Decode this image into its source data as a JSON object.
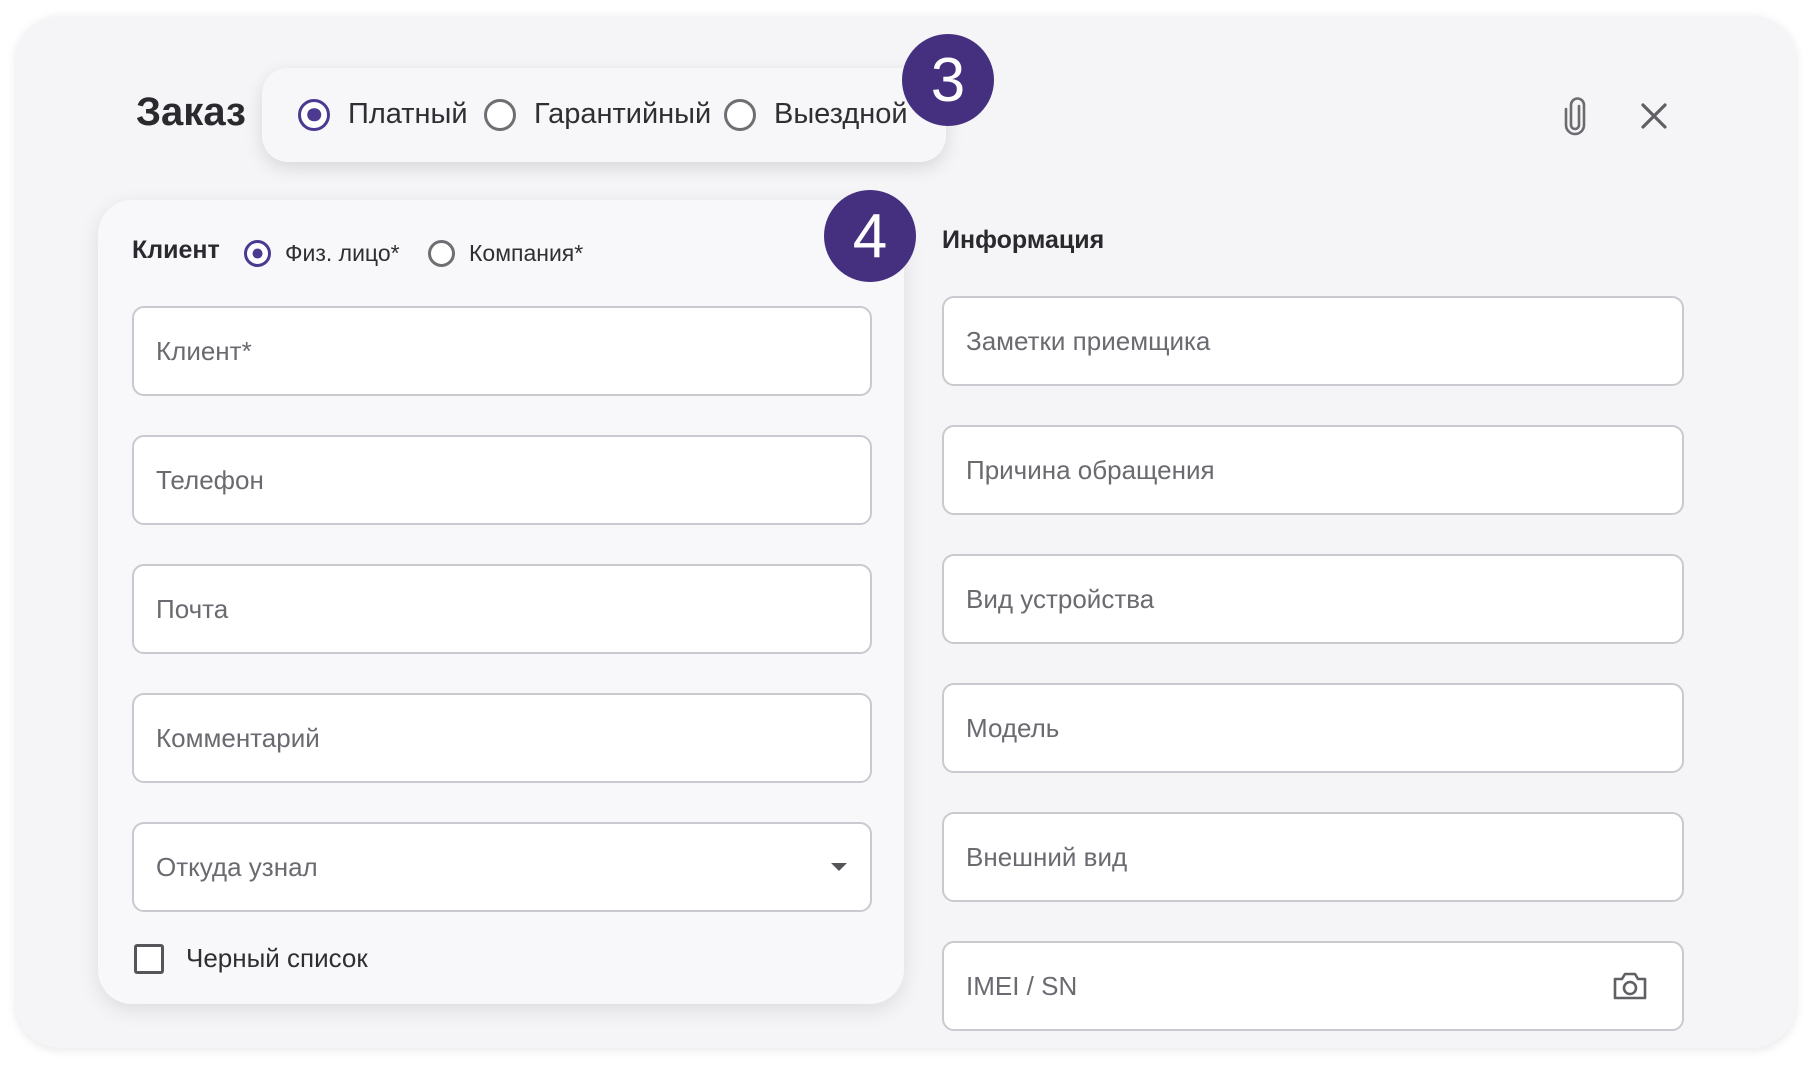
{
  "dialog": {
    "title": "Заказ",
    "order_types": [
      {
        "label": "Платный",
        "selected": true
      },
      {
        "label": "Гарантийный",
        "selected": false
      },
      {
        "label": "Выездной",
        "selected": false
      }
    ],
    "attach_icon": "paperclip-icon",
    "close_icon": "close-icon"
  },
  "badges": {
    "step3": "3",
    "step4": "4",
    "color": "#45307f"
  },
  "client": {
    "heading": "Клиент",
    "types": [
      {
        "label": "Физ. лицо*",
        "selected": true
      },
      {
        "label": "Компания*",
        "selected": false
      }
    ],
    "fields": [
      {
        "placeholder": "Клиент*"
      },
      {
        "placeholder": "Телефон"
      },
      {
        "placeholder": "Почта"
      },
      {
        "placeholder": "Комментарий"
      },
      {
        "placeholder": "Откуда узнал",
        "type": "select"
      }
    ],
    "blacklist": {
      "label": "Черный список",
      "checked": false
    }
  },
  "info": {
    "heading": "Информация",
    "fields": [
      {
        "placeholder": "Заметки приемщика"
      },
      {
        "placeholder": "Причина обращения"
      },
      {
        "placeholder": "Вид устройства"
      },
      {
        "placeholder": "Модель"
      },
      {
        "placeholder": "Внешний вид"
      },
      {
        "placeholder": "IMEI / SN",
        "icon": "camera-icon"
      }
    ]
  },
  "colors": {
    "accent": "#4b3a8f",
    "background": "#f5f5f8",
    "field_border": "#c9c9cf"
  }
}
